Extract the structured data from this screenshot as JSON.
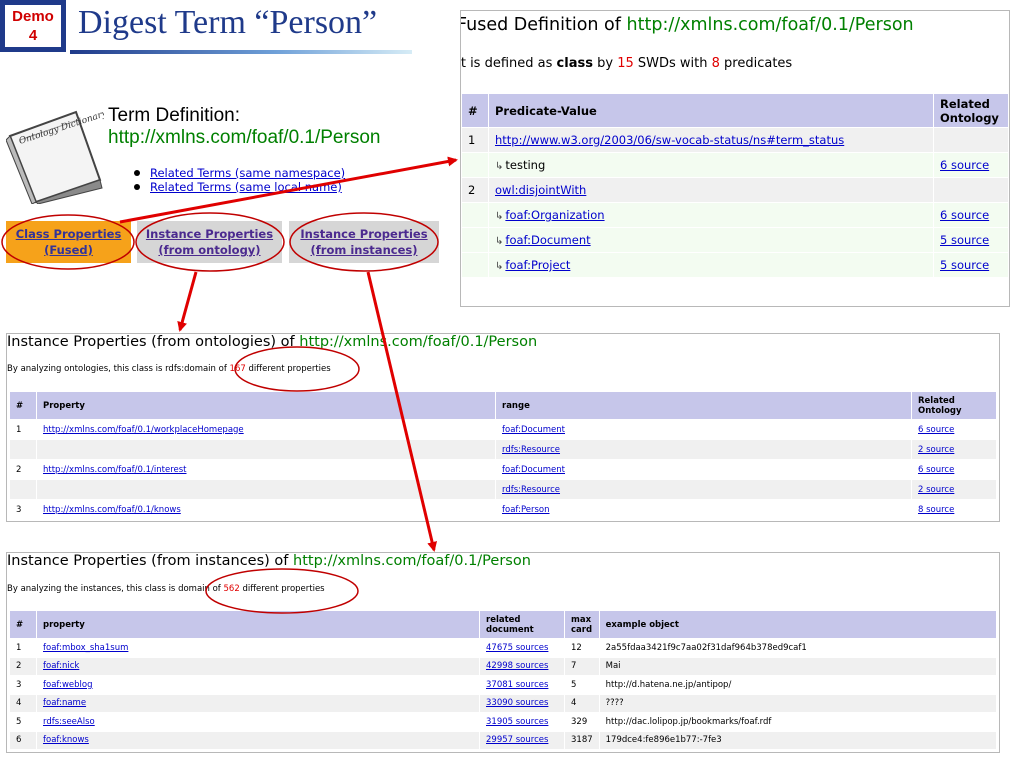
{
  "badge": {
    "line1": "Demo",
    "line2": "4"
  },
  "slide_title": "Digest Term “Person”",
  "book_label": "Ontology Dictionary",
  "term": {
    "label": "Term Definition:",
    "uri": "http://xmlns.com/foaf/0.1/Person",
    "links": [
      "Related Terms (same namespace)",
      "Related Terms (same local name)"
    ]
  },
  "buttons": {
    "class_fused": [
      "Class Properties",
      "(Fused)"
    ],
    "instance_ontology": [
      "Instance Properties",
      "(from ontology)"
    ],
    "instance_instances": [
      "Instance Properties",
      "(from instances)"
    ]
  },
  "fused": {
    "title_prefix": "Fused Definition of",
    "uri": "http://xmlns.com/foaf/0.1/Person",
    "sub_1": "It is defined as",
    "sub_class": "class",
    "sub_by": "by",
    "swd_count": "15",
    "sub_swds": "SWDs with",
    "pred_count": "8",
    "sub_predicates": "predicates",
    "headers": [
      "#",
      "Predicate-Value",
      "Related Ontology"
    ],
    "rows": [
      {
        "num": "1",
        "value": "http://www.w3.org/2003/06/sw-vocab-status/ns#term_status",
        "link": true,
        "sub": false,
        "source": ""
      },
      {
        "num": "",
        "value": "testing",
        "link": false,
        "sub": true,
        "source": "6 source"
      },
      {
        "num": "2",
        "value": "owl:disjointWith",
        "link": true,
        "sub": false,
        "source": ""
      },
      {
        "num": "",
        "value": "foaf:Organization",
        "link": true,
        "sub": true,
        "source": "6 source"
      },
      {
        "num": "",
        "value": "foaf:Document",
        "link": true,
        "sub": true,
        "source": "5 source"
      },
      {
        "num": "",
        "value": "foaf:Project",
        "link": true,
        "sub": true,
        "source": "5 source"
      }
    ]
  },
  "ont_panel": {
    "title_prefix": "Instance Properties (from ontologies) of",
    "uri": "http://xmlns.com/foaf/0.1/Person",
    "sub_pre": "By analyzing ontologies, this class is rdfs:domain of",
    "count": "167",
    "sub_post": "different properties",
    "headers": [
      "#",
      "Property",
      "range",
      "Related Ontology"
    ],
    "rows": [
      {
        "num": "1",
        "property": "http://xmlns.com/foaf/0.1/workplaceHomepage",
        "range": "foaf:Document",
        "source": "6 source"
      },
      {
        "num": "",
        "property": "",
        "range": "rdfs:Resource",
        "source": "2 source"
      },
      {
        "num": "2",
        "property": "http://xmlns.com/foaf/0.1/interest",
        "range": "foaf:Document",
        "source": "6 source"
      },
      {
        "num": "",
        "property": "",
        "range": "rdfs:Resource",
        "source": "2 source"
      },
      {
        "num": "3",
        "property": "http://xmlns.com/foaf/0.1/knows",
        "range": "foaf:Person",
        "source": "8 source"
      }
    ]
  },
  "inst_panel": {
    "title_prefix": "Instance Properties (from instances) of",
    "uri": "http://xmlns.com/foaf/0.1/Person",
    "sub_pre": "By analyzing the instances, this class is domain of",
    "count": "562",
    "sub_post": "different properties",
    "headers": [
      "#",
      "property",
      "related document",
      "max card",
      "example object"
    ],
    "rows": [
      {
        "num": "1",
        "property": "foaf:mbox_sha1sum",
        "doc": "47675 sources",
        "card": "12",
        "example": "2a55fdaa3421f9c7aa02f31daf964b378ed9caf1"
      },
      {
        "num": "2",
        "property": "foaf:nick",
        "doc": "42998 sources",
        "card": "7",
        "example": "Mai"
      },
      {
        "num": "3",
        "property": "foaf:weblog",
        "doc": "37081 sources",
        "card": "5",
        "example": "http://d.hatena.ne.jp/antipop/"
      },
      {
        "num": "4",
        "property": "foaf:name",
        "doc": "33090 sources",
        "card": "4",
        "example": "????"
      },
      {
        "num": "5",
        "property": "rdfs:seeAlso",
        "doc": "31905 sources",
        "card": "329",
        "example": "http://dac.lolipop.jp/bookmarks/foaf.rdf"
      },
      {
        "num": "6",
        "property": "foaf:knows",
        "doc": "29957 sources",
        "card": "3187",
        "example": "179dce4:fe896e1b77:-7fe3"
      }
    ]
  },
  "colors": {
    "accent_red": "#e00000",
    "uri_green": "#008000",
    "header_lavender": "#c6c6ea",
    "title_blue": "#1f3a8a"
  }
}
